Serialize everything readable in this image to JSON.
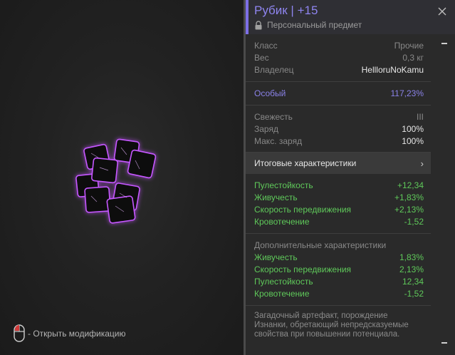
{
  "item": {
    "title": "Рубик | +15",
    "subtitle": "Персональный предмет"
  },
  "base": [
    {
      "label": "Класс",
      "value": "Прочие"
    },
    {
      "label": "Вес",
      "value": "0,3 кг"
    },
    {
      "label": "Владелец",
      "value": "HellloruNoKamu"
    }
  ],
  "special": {
    "label": "Особый",
    "value": "117,23%"
  },
  "condition": [
    {
      "label": "Свежесть",
      "value": "III"
    },
    {
      "label": "Заряд",
      "value": "100%"
    },
    {
      "label": "Макс. заряд",
      "value": "100%"
    }
  ],
  "totals": {
    "label": "Итоговые характеристики",
    "chevron": "›",
    "stats": [
      {
        "label": "Пулестойкость",
        "value": "+12,34"
      },
      {
        "label": "Живучесть",
        "value": "+1,83%"
      },
      {
        "label": "Скорость передвижения",
        "value": "+2,13%"
      },
      {
        "label": "Кровотечение",
        "value": "-1,52"
      }
    ]
  },
  "additional": {
    "label": "Дополнительные характеристики",
    "stats": [
      {
        "label": "Живучесть",
        "value": "1,83%"
      },
      {
        "label": "Скорость передвижения",
        "value": "2,13%"
      },
      {
        "label": "Пулестойкость",
        "value": "12,34"
      },
      {
        "label": "Кровотечение",
        "value": "-1,52"
      }
    ]
  },
  "description": "Загадочный артефакт, порождение Изнанки, обретающий непредсказуемые свойства при повышении потенциала.",
  "hint": "- Открыть модификацию",
  "icons": {
    "close": "close-icon",
    "lock": "lock-icon",
    "mouse": "mouse-icon"
  },
  "colors": {
    "accent": "#8f85f0",
    "positive": "#5fc95a",
    "special": "#8a82e8",
    "glow": "#c050ff"
  }
}
